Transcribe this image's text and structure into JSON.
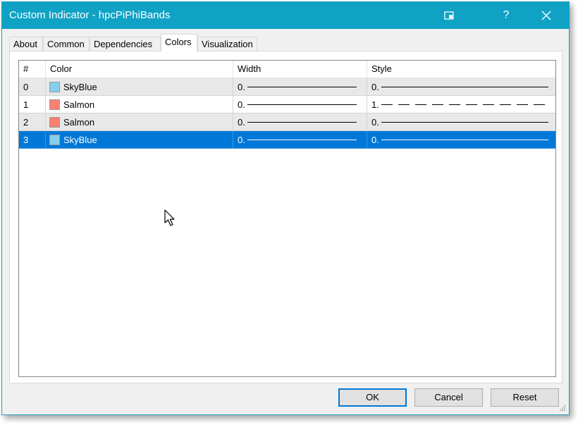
{
  "window": {
    "title": "Custom Indicator - hpcPiPhiBands",
    "help_label": "?",
    "controls": [
      "restore-icon",
      "help-icon",
      "close-icon"
    ]
  },
  "tabs": [
    {
      "label": "About"
    },
    {
      "label": "Common"
    },
    {
      "label": "Dependencies"
    },
    {
      "label": "Colors",
      "active": true
    },
    {
      "label": "Visualization"
    }
  ],
  "grid": {
    "headers": {
      "index": "#",
      "color": "Color",
      "width": "Width",
      "style": "Style"
    },
    "rows": [
      {
        "index": "0",
        "color_name": "SkyBlue",
        "color_hex": "#87ceeb",
        "width": "0.",
        "style": "0.",
        "style_kind": "solid"
      },
      {
        "index": "1",
        "color_name": "Salmon",
        "color_hex": "#fa8072",
        "width": "0.",
        "style": "1.",
        "style_kind": "dashed"
      },
      {
        "index": "2",
        "color_name": "Salmon",
        "color_hex": "#fa8072",
        "width": "0.",
        "style": "0.",
        "style_kind": "solid"
      },
      {
        "index": "3",
        "color_name": "SkyBlue",
        "color_hex": "#87ceeb",
        "width": "0.",
        "style": "0.",
        "style_kind": "solid",
        "selected": true
      }
    ]
  },
  "buttons": {
    "ok": "OK",
    "cancel": "Cancel",
    "reset": "Reset"
  },
  "colors": {
    "titlebar": "#0fa2c4",
    "selection": "#0078d7"
  }
}
